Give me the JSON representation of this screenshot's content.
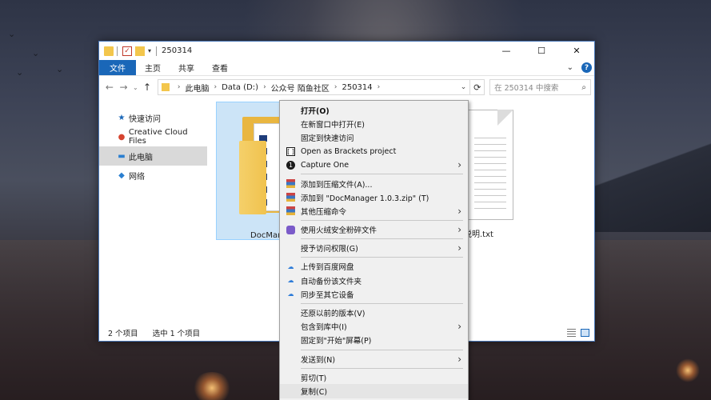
{
  "window": {
    "title": "250314",
    "controls": {
      "minimize": "—",
      "maximize": "☐",
      "close": "✕"
    }
  },
  "ribbon": {
    "tabs": [
      "文件",
      "主页",
      "共享",
      "查看"
    ],
    "help": "?",
    "collapse": "⌄"
  },
  "address": {
    "back": "←",
    "forward": "→",
    "recent": "⌄",
    "up": "↑",
    "path": [
      "此电脑",
      "Data (D:)",
      "公众号 陌鱼社区",
      "250314"
    ],
    "separator": "›",
    "dropdown": "⌄",
    "refresh": "⟳",
    "search_placeholder": "在 250314 中搜索",
    "search_icon": "⌕"
  },
  "nav_pane": {
    "items": [
      {
        "label": "快速访问",
        "icon": "star-icon"
      },
      {
        "label": "Creative Cloud Files",
        "icon": "creative-cloud-icon"
      },
      {
        "label": "此电脑",
        "icon": "computer-icon",
        "selected": true
      },
      {
        "label": "网络",
        "icon": "network-icon"
      }
    ]
  },
  "files": [
    {
      "name": "DocMan",
      "type": "folder",
      "selected": true
    },
    {
      "name": "说明.txt",
      "type": "text"
    }
  ],
  "status": {
    "count": "2 个项目",
    "selected": "选中 1 个项目"
  },
  "context_menu": {
    "groups": [
      [
        {
          "label": "打开(O)",
          "bold": true
        },
        {
          "label": "在新窗口中打开(E)"
        },
        {
          "label": "固定到快速访问"
        },
        {
          "label": "Open as Brackets project",
          "icon": "brackets-icon"
        },
        {
          "label": "Capture One",
          "icon": "capture-one-icon",
          "submenu": true
        }
      ],
      [
        {
          "label": "添加到压缩文件(A)...",
          "icon": "archive-icon"
        },
        {
          "label": "添加到 \"DocManager 1.0.3.zip\" (T)",
          "icon": "archive-icon"
        },
        {
          "label": "其他压缩命令",
          "icon": "archive-icon",
          "submenu": true
        }
      ],
      [
        {
          "label": "使用火绒安全粉碎文件",
          "icon": "huorong-icon",
          "submenu": true
        }
      ],
      [
        {
          "label": "授予访问权限(G)",
          "submenu": true
        }
      ],
      [
        {
          "label": "上传到百度网盘",
          "icon": "baidu-netdisk-icon"
        },
        {
          "label": "自动备份该文件夹",
          "icon": "baidu-netdisk-icon"
        },
        {
          "label": "同步至其它设备",
          "icon": "baidu-netdisk-icon"
        }
      ],
      [
        {
          "label": "还原以前的版本(V)"
        },
        {
          "label": "包含到库中(I)",
          "submenu": true
        },
        {
          "label": "固定到\"开始\"屏幕(P)"
        }
      ],
      [
        {
          "label": "发送到(N)",
          "submenu": true
        }
      ],
      [
        {
          "label": "剪切(T)"
        },
        {
          "label": "复制(C)",
          "hover": true
        }
      ]
    ]
  }
}
